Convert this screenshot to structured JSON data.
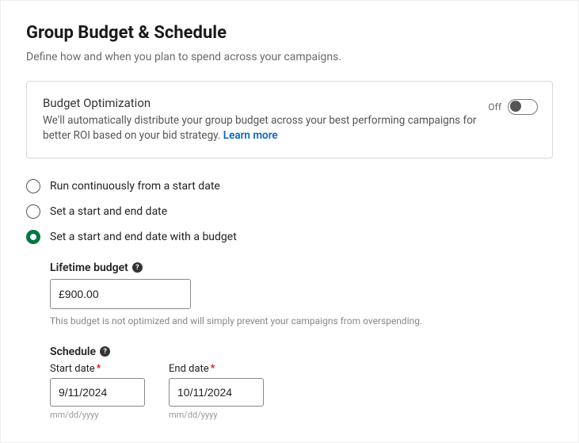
{
  "header": {
    "title": "Group Budget & Schedule",
    "subtitle": "Define how and when you plan to spend across your campaigns."
  },
  "optimization_card": {
    "title": "Budget Optimization",
    "description": "We'll automatically distribute your group budget across your best performing campaigns for better ROI based on your bid strategy. ",
    "learn_more": "Learn more",
    "toggle_state_label": "Off",
    "toggle_on": false
  },
  "schedule_options": {
    "opt1": "Run continuously from a start date",
    "opt2": "Set a start and end date",
    "opt3": "Set a start and end date with a budget",
    "selected": "opt3"
  },
  "lifetime_budget": {
    "label": "Lifetime budget",
    "value": "£900.00",
    "helper": "This budget is not optimized and will simply prevent your campaigns from overspending."
  },
  "schedule": {
    "label": "Schedule",
    "start_label": "Start date",
    "end_label": "End date",
    "start_value": "9/11/2024",
    "end_value": "10/11/2024",
    "format_hint": "mm/dd/yyyy"
  }
}
